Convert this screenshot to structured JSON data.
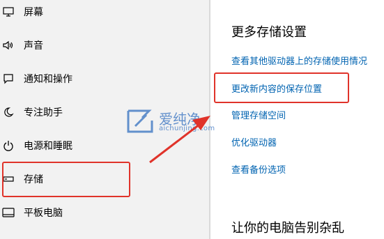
{
  "sidebar": {
    "items": [
      {
        "label": "屏幕",
        "icon": "monitor-icon"
      },
      {
        "label": "声音",
        "icon": "speaker-icon"
      },
      {
        "label": "通知和操作",
        "icon": "notification-icon"
      },
      {
        "label": "专注助手",
        "icon": "moon-icon"
      },
      {
        "label": "电源和睡眠",
        "icon": "power-icon"
      },
      {
        "label": "存储",
        "icon": "storage-icon"
      },
      {
        "label": "平板电脑",
        "icon": "tablet-icon"
      }
    ]
  },
  "main": {
    "section1_title": "更多存储设置",
    "links": [
      "查看其他驱动器上的存储使用情况",
      "更改新内容的保存位置",
      "管理存储空间",
      "优化驱动器",
      "查看备份选项"
    ],
    "section2_title": "让你的电脑告别杂乱"
  },
  "watermark": {
    "text": "爱纯净",
    "sub": "aichunjing.com"
  },
  "colors": {
    "link": "#0063b1",
    "highlight": "#e0332a",
    "sidebar_bg": "#f2f2f2"
  }
}
